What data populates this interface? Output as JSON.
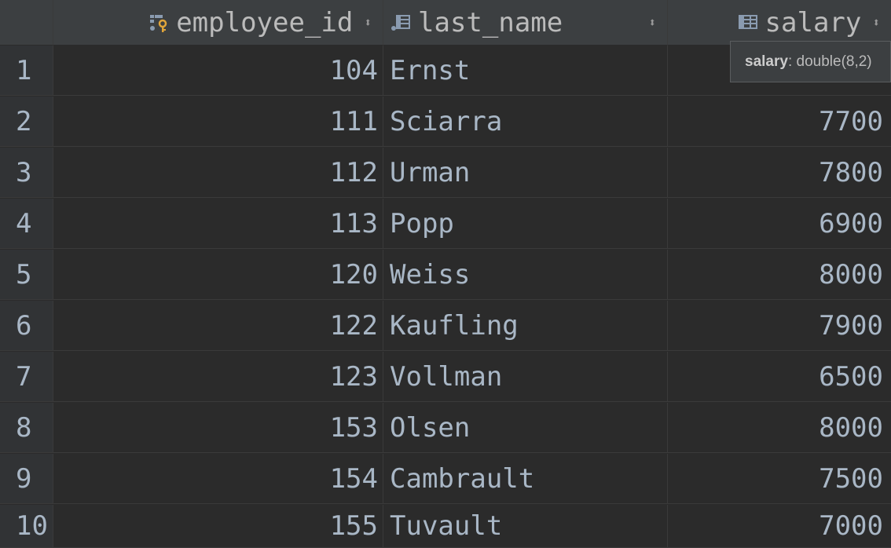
{
  "columns": [
    {
      "name": "employee_id",
      "icon": "primary-key-column-icon"
    },
    {
      "name": "last_name",
      "icon": "column-icon"
    },
    {
      "name": "salary",
      "icon": "column-icon"
    }
  ],
  "sort_glyph": "⬍",
  "rows": [
    {
      "num": "1",
      "employee_id": "104",
      "last_name": "Ernst",
      "salary": ""
    },
    {
      "num": "2",
      "employee_id": "111",
      "last_name": "Sciarra",
      "salary": "7700"
    },
    {
      "num": "3",
      "employee_id": "112",
      "last_name": "Urman",
      "salary": "7800"
    },
    {
      "num": "4",
      "employee_id": "113",
      "last_name": "Popp",
      "salary": "6900"
    },
    {
      "num": "5",
      "employee_id": "120",
      "last_name": "Weiss",
      "salary": "8000"
    },
    {
      "num": "6",
      "employee_id": "122",
      "last_name": "Kaufling",
      "salary": "7900"
    },
    {
      "num": "7",
      "employee_id": "123",
      "last_name": "Vollman",
      "salary": "6500"
    },
    {
      "num": "8",
      "employee_id": "153",
      "last_name": "Olsen",
      "salary": "8000"
    },
    {
      "num": "9",
      "employee_id": "154",
      "last_name": "Cambrault",
      "salary": "7500"
    },
    {
      "num": "10",
      "employee_id": "155",
      "last_name": "Tuvault",
      "salary": "7000"
    }
  ],
  "tooltip": {
    "name": "salary",
    "type": ": double(8,2)"
  },
  "colors": {
    "background": "#2b2b2b",
    "header": "#3c3f41",
    "text": "#a9b7c6",
    "key_icon": "#e0a53a"
  }
}
